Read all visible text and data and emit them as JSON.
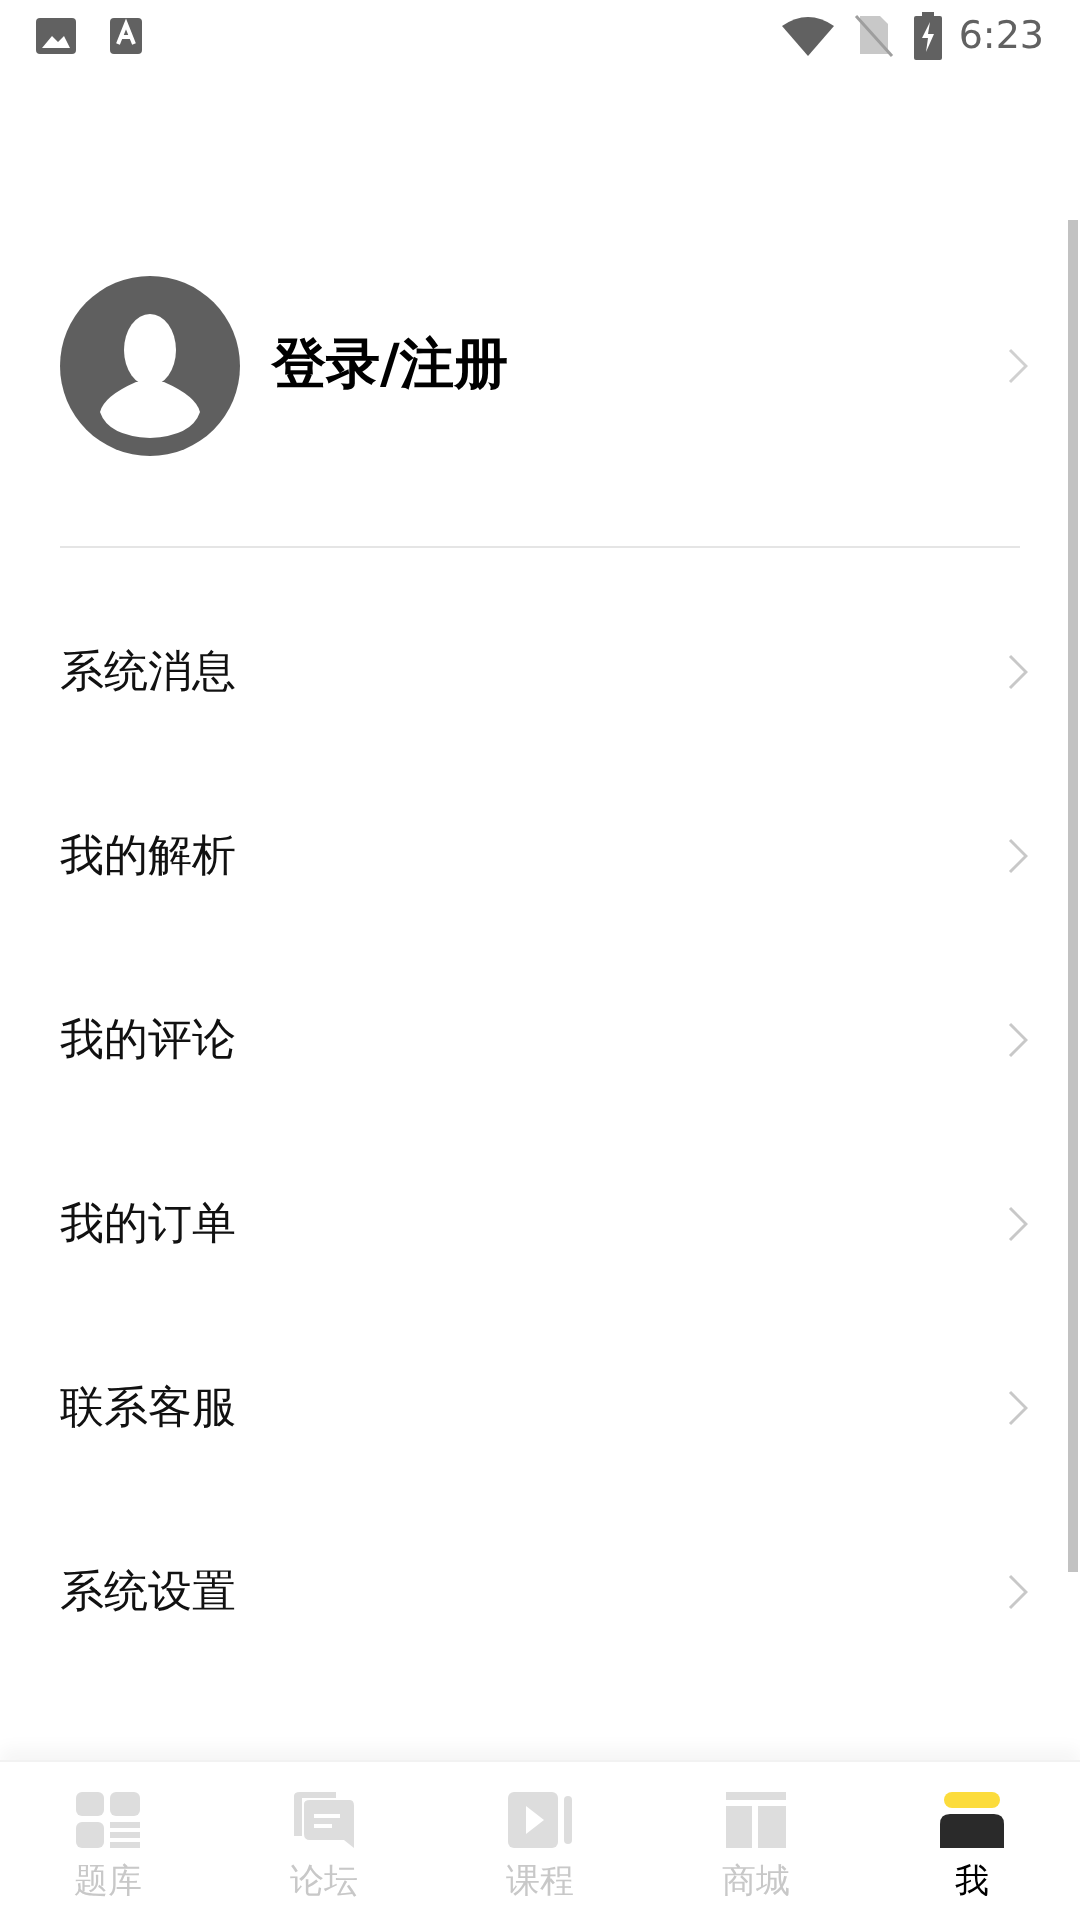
{
  "status_bar": {
    "time": "6:23"
  },
  "profile": {
    "label": "登录/注册"
  },
  "menu": [
    {
      "label": "系统消息"
    },
    {
      "label": "我的解析"
    },
    {
      "label": "我的评论"
    },
    {
      "label": "我的订单"
    },
    {
      "label": "联系客服"
    },
    {
      "label": "系统设置"
    }
  ],
  "tabs": [
    {
      "label": "题库",
      "kind": "grid",
      "selected": false
    },
    {
      "label": "论坛",
      "kind": "chat",
      "selected": false
    },
    {
      "label": "课程",
      "kind": "play",
      "selected": false
    },
    {
      "label": "商城",
      "kind": "store",
      "selected": false
    },
    {
      "label": "我",
      "kind": "person",
      "selected": true
    }
  ]
}
